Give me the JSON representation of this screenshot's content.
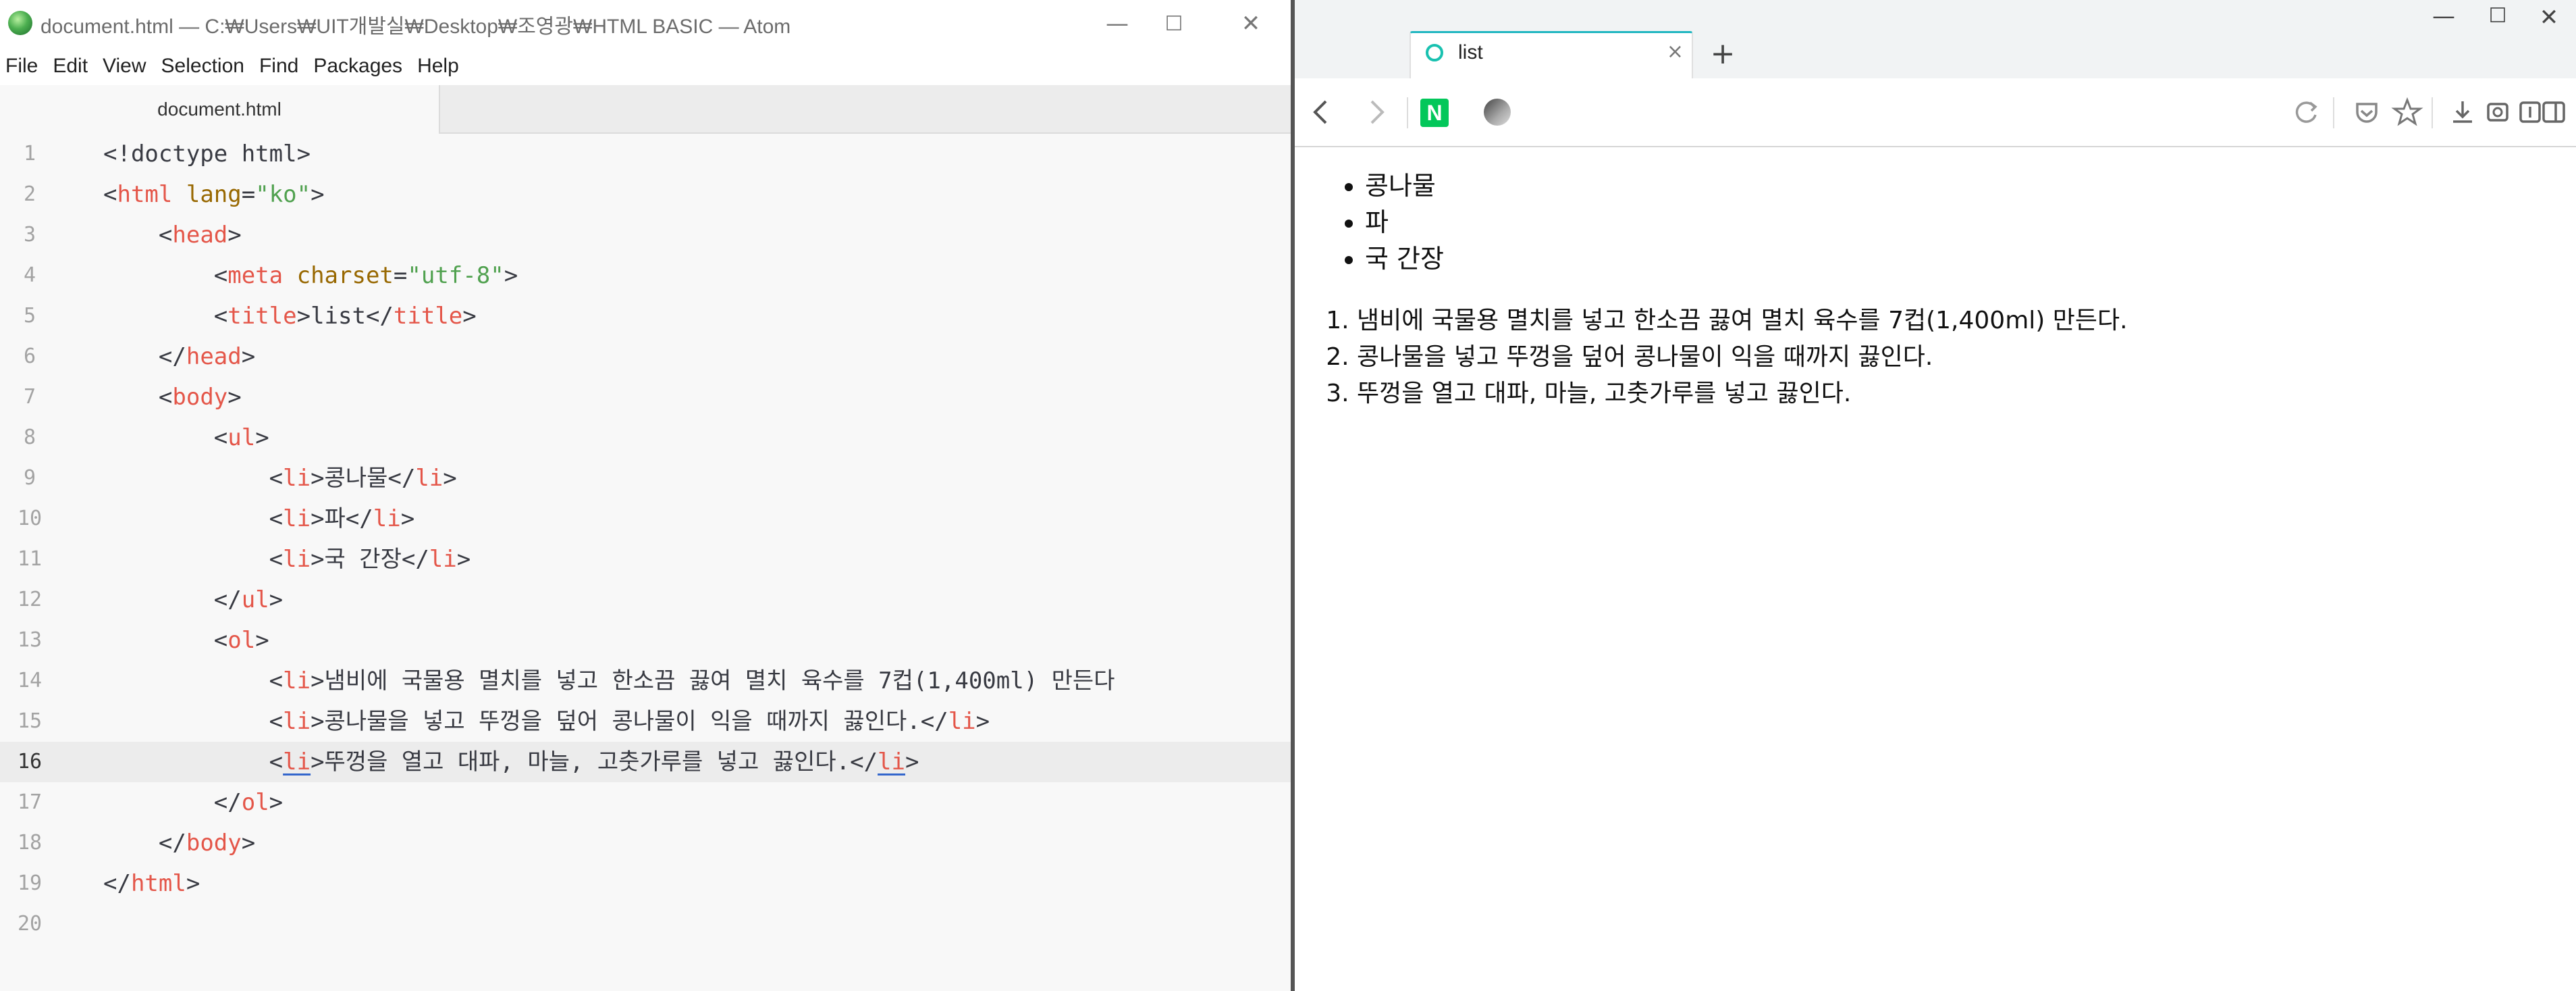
{
  "atom": {
    "title": "document.html — C:₩Users₩UIT개발실₩Desktop₩조영광₩HTML BASIC — Atom",
    "menu": [
      "File",
      "Edit",
      "View",
      "Selection",
      "Find",
      "Packages",
      "Help"
    ],
    "tab_label": "document.html",
    "line_numbers": [
      "1",
      "2",
      "3",
      "4",
      "5",
      "6",
      "7",
      "8",
      "9",
      "10",
      "11",
      "12",
      "13",
      "14",
      "15",
      "16",
      "17",
      "18",
      "19",
      "20"
    ],
    "cursor_line": 16
  },
  "code": {
    "l1": {
      "ind": "",
      "a": "<!doctype html>"
    },
    "l2": {
      "ind": "",
      "open": "<",
      "tag": "html",
      "attr": " lang",
      "eq": "=",
      "val": "\"ko\"",
      "close": ">"
    },
    "l3": {
      "ind": "    ",
      "open": "<",
      "tag": "head",
      "close": ">"
    },
    "l4": {
      "ind": "        ",
      "open": "<",
      "tag": "meta",
      "attr": " charset",
      "eq": "=",
      "val": "\"utf-8\"",
      "close": ">"
    },
    "l5": {
      "ind": "        ",
      "open": "<",
      "tag": "title",
      "mid": ">list</",
      "tag2": "title",
      "close": ">"
    },
    "l6": {
      "ind": "    ",
      "open": "</",
      "tag": "head",
      "close": ">"
    },
    "l7": {
      "ind": "    ",
      "open": "<",
      "tag": "body",
      "close": ">"
    },
    "l8": {
      "ind": "        ",
      "open": "<",
      "tag": "ul",
      "close": ">"
    },
    "l9": {
      "ind": "            ",
      "open": "<",
      "tag": "li",
      "mid": ">콩나물</",
      "tag2": "li",
      "close": ">"
    },
    "l10": {
      "ind": "            ",
      "open": "<",
      "tag": "li",
      "mid": ">파</",
      "tag2": "li",
      "close": ">"
    },
    "l11": {
      "ind": "            ",
      "open": "<",
      "tag": "li",
      "mid": ">국 간장</",
      "tag2": "li",
      "close": ">"
    },
    "l12": {
      "ind": "        ",
      "open": "</",
      "tag": "ul",
      "close": ">"
    },
    "l13": {
      "ind": "        ",
      "open": "<",
      "tag": "ol",
      "close": ">"
    },
    "l14": {
      "ind": "            ",
      "open": "<",
      "tag": "li",
      "mid": ">냄비에 국물용 멸치를 넣고 한소끔 끓여 멸치 육수를 7컵(1,400ml) 만든다"
    },
    "l15": {
      "ind": "            ",
      "open": "<",
      "tag": "li",
      "mid": ">콩나물을 넣고 뚜껑을 덮어 콩나물이 익을 때까지 끓인다.</",
      "tag2": "li",
      "close": ">"
    },
    "l16": {
      "ind": "            ",
      "open": "<",
      "tag": "li",
      "mid": ">뚜껑을 열고 대파, 마늘, 고춧가루를 넣고 끓인다.</",
      "tag2": "li",
      "close": ">"
    },
    "l17": {
      "ind": "        ",
      "open": "</",
      "tag": "ol",
      "close": ">"
    },
    "l18": {
      "ind": "    ",
      "open": "</",
      "tag": "body",
      "close": ">"
    },
    "l19": {
      "ind": "",
      "open": "</",
      "tag": "html",
      "close": ">"
    }
  },
  "browser": {
    "tab_title": "list",
    "tab_close": "×",
    "new_tab": "+",
    "naver_label": "N",
    "window_controls": {
      "minimize": "—",
      "maximize": "☐",
      "close": "✕"
    },
    "icons": [
      "back-icon",
      "forward-icon",
      "naver-icon",
      "whale-icon",
      "reload-icon",
      "pocket-icon",
      "bookmark-star-icon",
      "download-icon",
      "capture-icon",
      "reader-icon",
      "sidebar-icon",
      "profile-icon",
      "more-icon"
    ]
  },
  "page": {
    "ul": [
      "콩나물",
      "파",
      "국 간장"
    ],
    "ol": [
      "냄비에 국물용 멸치를 넣고 한소끔 끓여 멸치 육수를 7컵(1,400ml) 만든다.",
      "콩나물을 넣고 뚜껑을 덮어 콩나물이 익을 때까지 끓인다.",
      "뚜껑을 열고 대파, 마늘, 고춧가루를 넣고 끓인다."
    ]
  },
  "colors": {
    "tag": "#e45649",
    "attr": "#986801",
    "string": "#50a14f",
    "naver_green": "#03c75a",
    "tab_accent": "#1fb6c0"
  }
}
